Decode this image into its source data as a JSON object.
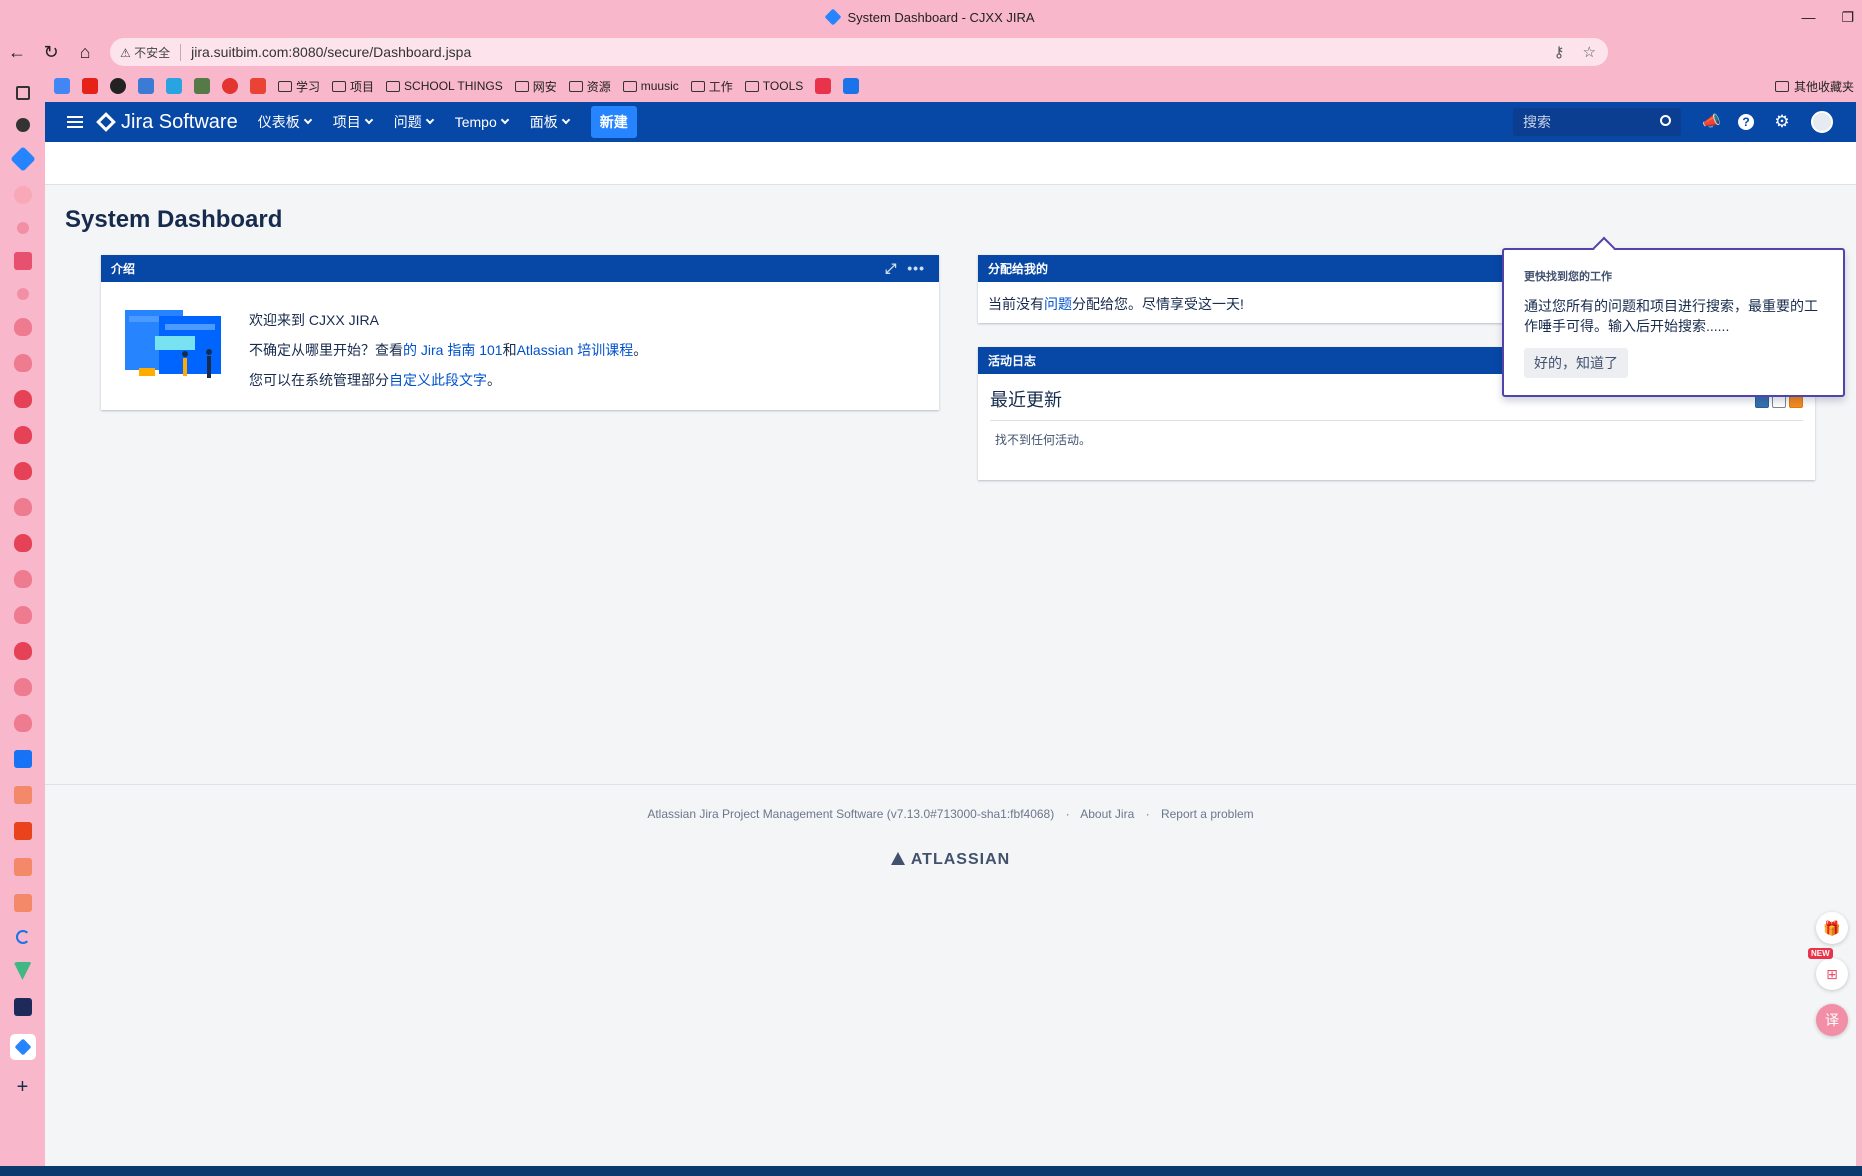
{
  "browser": {
    "tab_title": "System Dashboard - CJXX JIRA",
    "insecure_label": "不安全",
    "url": "jira.suitbim.com:8080/secure/Dashboard.jspa",
    "bookmarks": [
      "学习",
      "项目",
      "SCHOOL THINGS",
      "网安",
      "资源",
      "muusic",
      "工作",
      "TOOLS"
    ],
    "other_bookmarks": "其他收藏夹"
  },
  "header": {
    "product": "Jira Software",
    "menu": [
      {
        "label": "仪表板"
      },
      {
        "label": "项目"
      },
      {
        "label": "问题"
      },
      {
        "label": "Tempo"
      },
      {
        "label": "面板"
      }
    ],
    "create_label": "新建",
    "search_placeholder": "搜索"
  },
  "page": {
    "title": "System Dashboard"
  },
  "intro": {
    "title": "介绍",
    "line1": "欢迎来到 CJXX JIRA",
    "line2_prefix": "不确定从哪里开始？查看",
    "line2_link1": "的 Jira 指南 101",
    "line2_mid": "和",
    "line2_link2": "Atlassian 培训课程",
    "line2_suffix": "。",
    "line3_prefix": "您可以在系统管理部分",
    "line3_link": "自定义此段文字",
    "line3_suffix": "。"
  },
  "assigned": {
    "title": "分配给我的",
    "text_prefix": "当前没有",
    "text_link": "问题",
    "text_suffix": "分配给您。尽情享受这一天!"
  },
  "activity": {
    "title": "活动日志",
    "stream_title": "最近更新",
    "empty": "找不到任何活动。"
  },
  "tip": {
    "title": "更快找到您的工作",
    "body": "通过您所有的问题和项目进行搜索，最重要的工作唾手可得。输入后开始搜索......",
    "button": "好的，知道了"
  },
  "footer": {
    "version": "Atlassian Jira Project Management Software (v7.13.0#713000-sha1:fbf4068)",
    "about": "About Jira",
    "report": "Report a problem",
    "brand": "ATLASSIAN"
  },
  "floats": {
    "new_badge": "NEW"
  },
  "colors": {
    "header": "#0747a6",
    "accent": "#2684ff",
    "tip_border": "#5243aa",
    "browser_chrome": "#f8b7ca"
  }
}
